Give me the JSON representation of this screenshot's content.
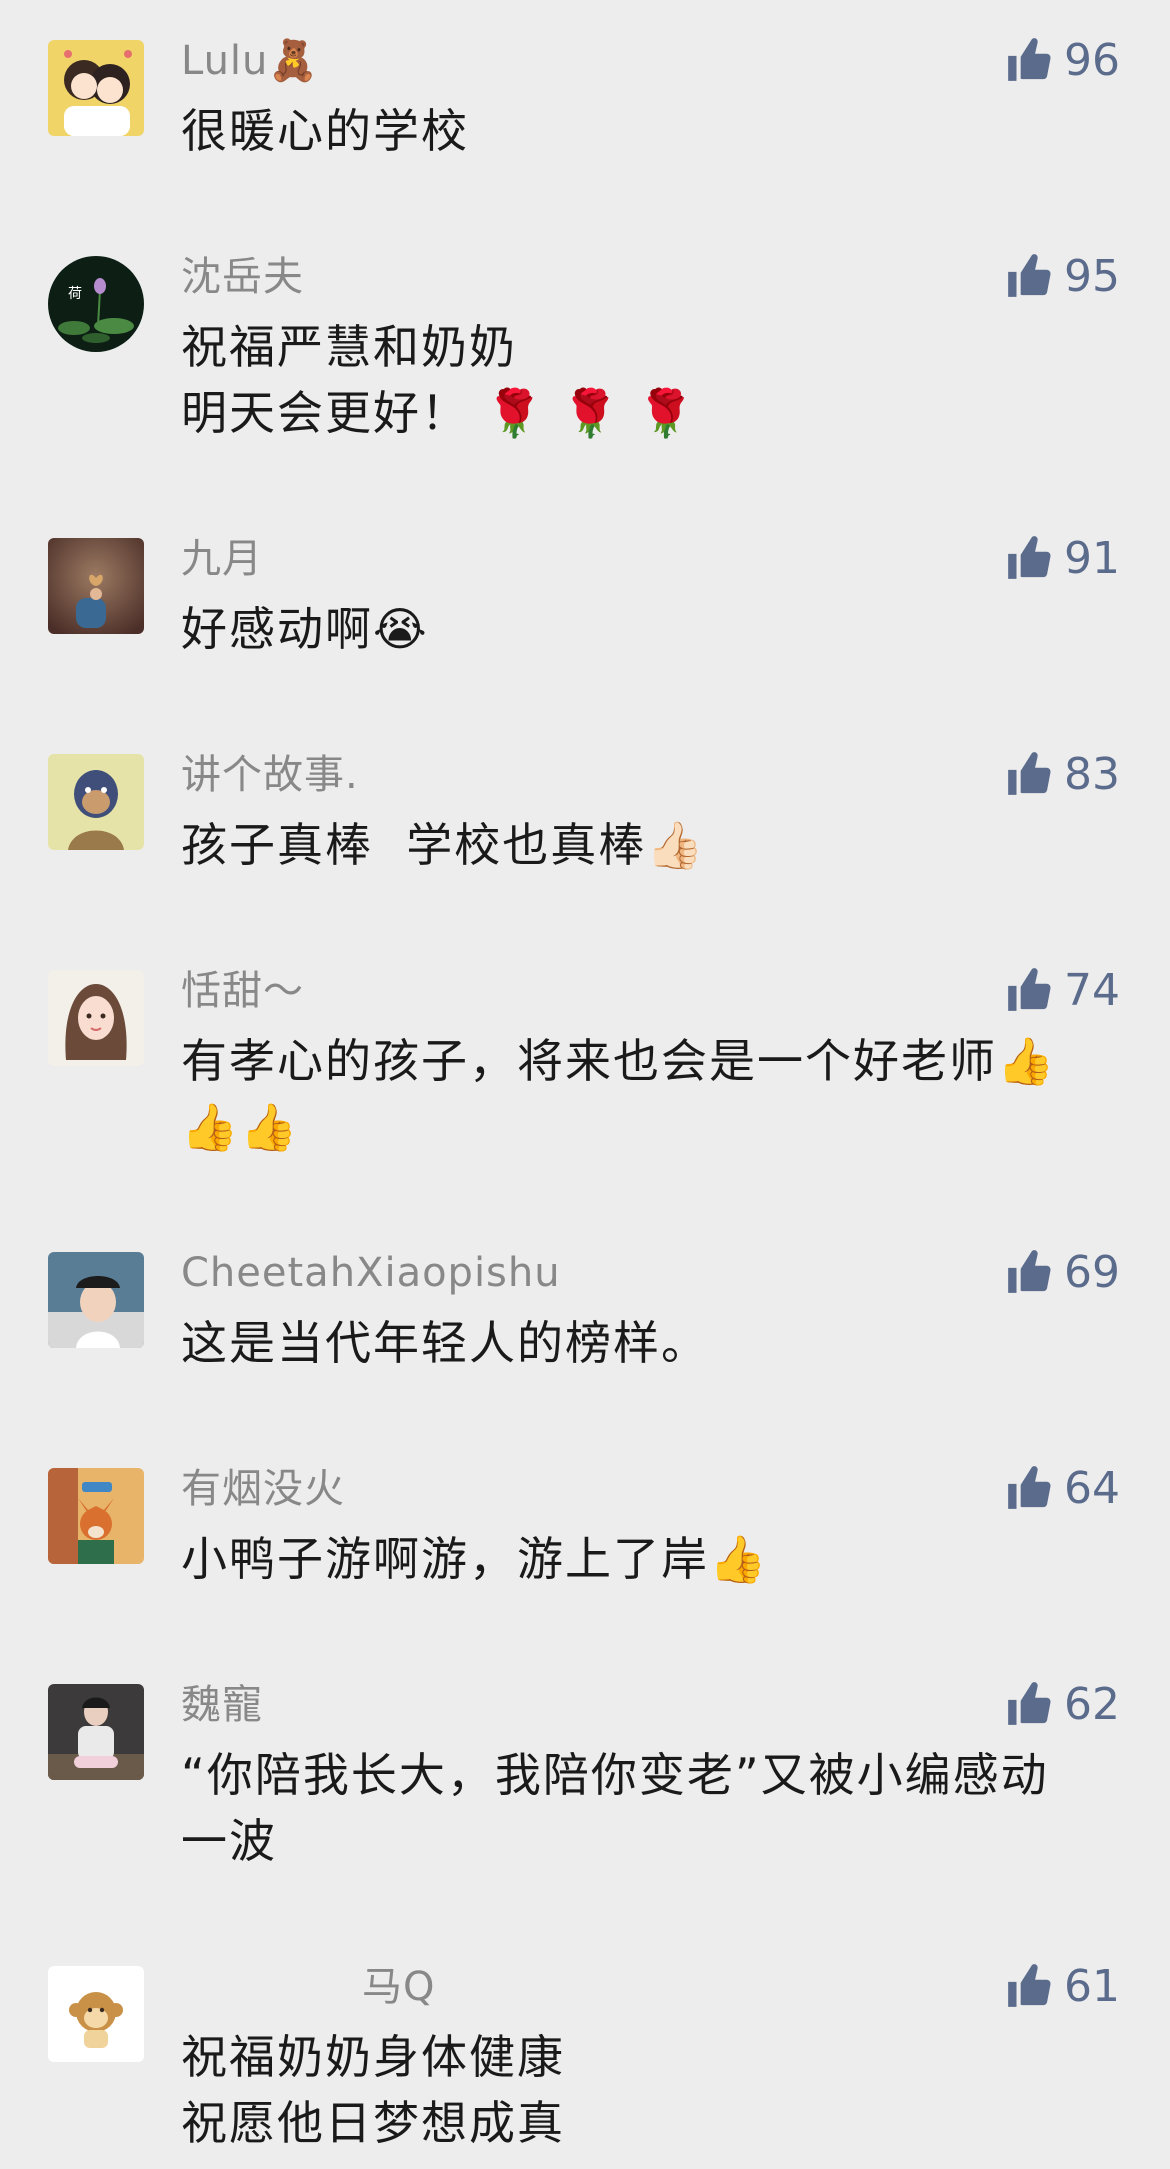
{
  "comments": [
    {
      "name": "Lulu🧸",
      "text": "很暖心的学校",
      "likes": "96",
      "avatar_icon": "two-girls-avatar-icon",
      "avatar_color": "#f0d468"
    },
    {
      "name": "沈岳夫",
      "text": "祝福严慧和奶奶\n明天会更好！ 🌹 🌹 🌹",
      "likes": "95",
      "avatar_icon": "lotus-avatar-icon",
      "avatar_color": "#0d1f14"
    },
    {
      "name": "九月",
      "text": "好感动啊😭",
      "likes": "91",
      "avatar_icon": "leaf-hand-avatar-icon",
      "avatar_color": "#7a5a4a"
    },
    {
      "name": "讲个故事.",
      "text": "孩子真棒  学校也真棒👍🏻",
      "likes": "83",
      "avatar_icon": "ape-avatar-icon",
      "avatar_color": "#e6e3a8"
    },
    {
      "name": "恬甜～",
      "text": "有孝心的孩子，将来也会是一个好老师👍\n👍👍",
      "likes": "74",
      "avatar_icon": "girl-illustration-avatar-icon",
      "avatar_color": "#f3efe9"
    },
    {
      "name": "CheetahXiaopishu",
      "text": "这是当代年轻人的榜样。",
      "likes": "69",
      "avatar_icon": "person-cap-avatar-icon",
      "avatar_color": "#5a7d96"
    },
    {
      "name": "有烟没火",
      "text": "小鸭子游啊游，游上了岸👍",
      "likes": "64",
      "avatar_icon": "fox-avatar-icon",
      "avatar_color": "#c9682e"
    },
    {
      "name": "魏寵",
      "text": "“你陪我长大，我陪你变老”又被小编感动\n一波",
      "likes": "62",
      "avatar_icon": "seated-person-avatar-icon",
      "avatar_color": "#3c3a3a"
    },
    {
      "name": "马Q",
      "text": "祝福奶奶身体健康\n祝愿他日梦想成真",
      "likes": "61",
      "avatar_icon": "monkey-avatar-icon",
      "avatar_color": "#ffffff"
    }
  ],
  "colors": {
    "background": "#ededed",
    "name_gray": "#888888",
    "text_black": "#1a1a1a",
    "like_blue": "#5b6b8c"
  }
}
